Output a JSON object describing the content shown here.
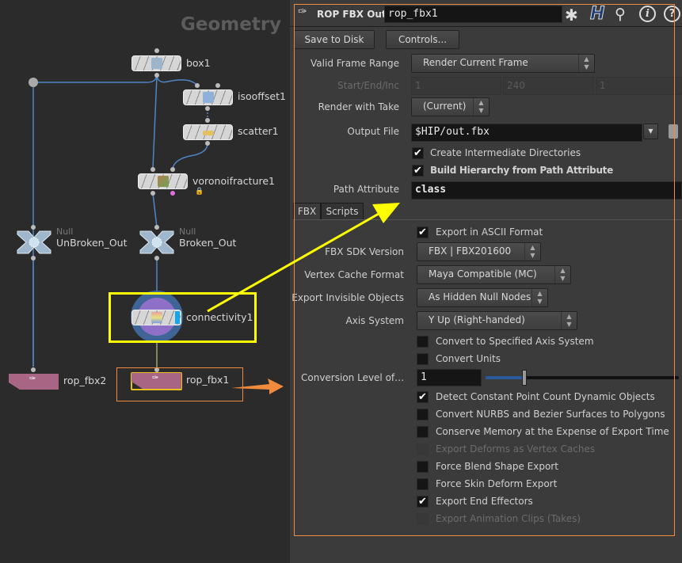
{
  "network": {
    "context_label": "Geometry",
    "nodes": {
      "box1": "box1",
      "isooffset1": "isooffset1",
      "scatter1": "scatter1",
      "voronoifracture1": "voronoifracture1",
      "unbroken": {
        "type": "Null",
        "name": "UnBroken_Out"
      },
      "broken": {
        "type": "Null",
        "name": "Broken_Out"
      },
      "connectivity1": "connectivity1",
      "rop_fbx2": "rop_fbx2",
      "rop_fbx1": "rop_fbx1"
    },
    "colors": {
      "wire": "#4f86c6",
      "highlight_box": "#ffff00",
      "selected_box": "#f08a3c",
      "rop_node": "#a86684"
    }
  },
  "panel": {
    "header": {
      "node_type": "ROP FBX Output",
      "node_name": "rop_fbx1",
      "icons": [
        "gear-icon",
        "houdini-help-icon",
        "search-icon",
        "info-icon",
        "help-icon"
      ]
    },
    "buttons": {
      "save": "Save to Disk",
      "controls": "Controls..."
    },
    "valid_frame_range": {
      "label": "Valid Frame Range",
      "value": "Render Current Frame"
    },
    "start_end_inc": {
      "label": "Start/End/Inc",
      "start": "1",
      "end": "240",
      "inc": "1"
    },
    "render_with_take": {
      "label": "Render with Take",
      "value": "(Current)"
    },
    "output_file": {
      "label": "Output File",
      "value": "$HIP/out.fbx"
    },
    "create_dirs": {
      "label": "Create Intermediate Directories",
      "checked": true
    },
    "build_hierarchy": {
      "label": "Build Hierarchy from Path Attribute",
      "checked": true
    },
    "path_attribute": {
      "label": "Path Attribute",
      "value": "class"
    },
    "tabs": [
      "FBX",
      "Scripts"
    ],
    "fbx": {
      "export_ascii": {
        "label": "Export in ASCII Format",
        "checked": true
      },
      "sdk_version": {
        "label": "FBX SDK Version",
        "value": "FBX | FBX201600"
      },
      "vertex_cache": {
        "label": "Vertex Cache Format",
        "value": "Maya Compatible (MC)"
      },
      "invisible": {
        "label": "Export Invisible Objects",
        "value": "As Hidden Null Nodes"
      },
      "axis_system": {
        "label": "Axis System",
        "value": "Y Up (Right-handed)"
      },
      "convert_axis": {
        "label": "Convert to Specified Axis System",
        "checked": false
      },
      "convert_units": {
        "label": "Convert Units",
        "checked": false
      },
      "conversion_level": {
        "label": "Conversion Level of D...",
        "value": "1",
        "slider_fraction": 0.2
      },
      "checks": [
        {
          "label": "Detect Constant Point Count Dynamic Objects",
          "checked": true,
          "disabled": false
        },
        {
          "label": "Convert NURBS and Bezier Surfaces to Polygons",
          "checked": false,
          "disabled": false
        },
        {
          "label": "Conserve Memory at the Expense of Export Time",
          "checked": false,
          "disabled": false
        },
        {
          "label": "Export Deforms as Vertex Caches",
          "checked": false,
          "disabled": true
        },
        {
          "label": "Force Blend Shape Export",
          "checked": false,
          "disabled": false
        },
        {
          "label": "Force Skin Deform Export",
          "checked": false,
          "disabled": false
        },
        {
          "label": "Export End Effectors",
          "checked": true,
          "disabled": false
        },
        {
          "label": "Export Animation Clips (Takes)",
          "checked": false,
          "disabled": true
        }
      ]
    }
  }
}
